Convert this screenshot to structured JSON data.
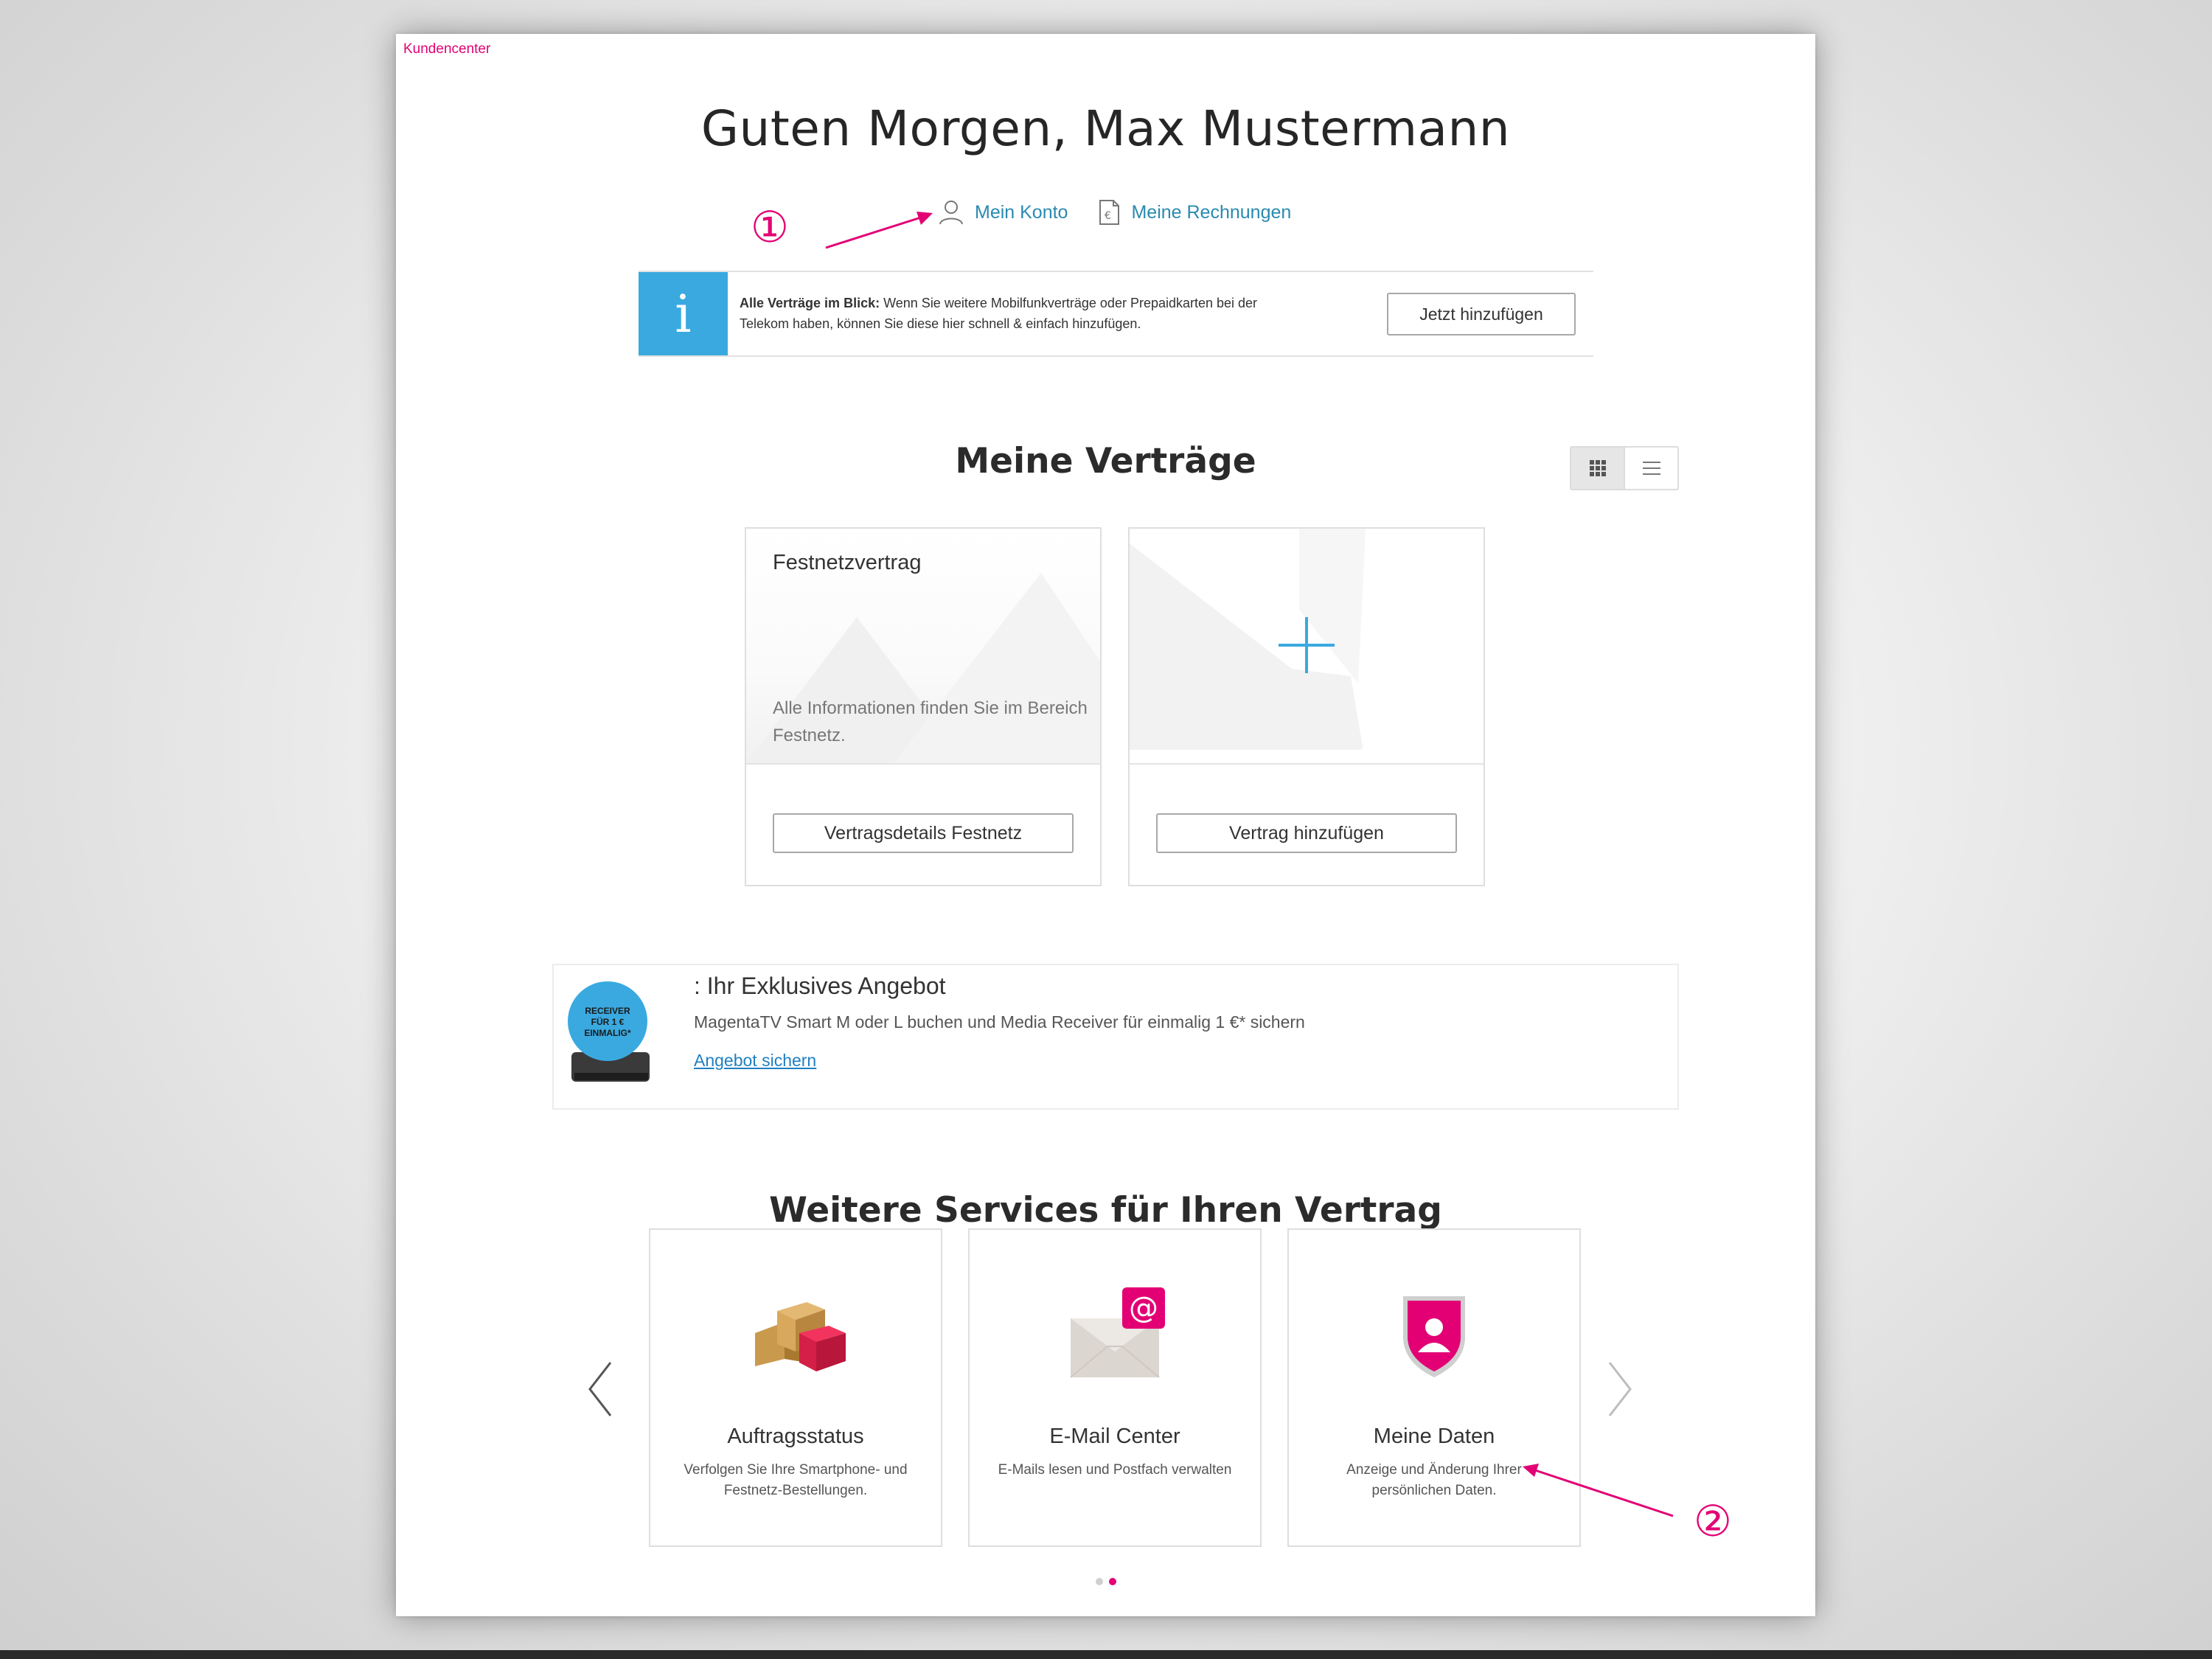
{
  "header": {
    "breadcrumb_link": "Kundencenter",
    "greeting": "Guten Morgen, Max Mustermann"
  },
  "topnav": {
    "account_label": "Mein Konto",
    "invoices_label": "Meine Rechnungen"
  },
  "annotations": {
    "marker_1": "①",
    "marker_2": "②"
  },
  "info_banner": {
    "icon": "info-icon",
    "bold_text": "Alle Verträge im Blick:",
    "text_line1": "Wenn Sie weitere Mobilfunkverträge oder Prepaidkarten bei der",
    "text_line2": "Telekom haben, können Sie diese hier schnell & einfach hinzufügen.",
    "button_label": "Jetzt hinzufügen"
  },
  "contracts": {
    "title": "Meine Verträge",
    "view_options": [
      "grid",
      "list"
    ],
    "selected_view": "grid",
    "cards": [
      {
        "title": "Festnetzvertrag",
        "description": "Alle Informationen finden Sie im Bereich Festnetz.",
        "button_label": "Vertragsdetails Festnetz"
      },
      {
        "icon": "plus-icon",
        "button_label": "Vertrag hinzufügen"
      }
    ]
  },
  "offer": {
    "badge_lines": [
      "RECEIVER",
      "FÜR 1 €",
      "EINMALIG*"
    ],
    "title": ": Ihr Exklusives Angebot",
    "text": "MagentaTV Smart M oder L buchen und Media Receiver für einmalig 1 €* sichern",
    "link_label": "Angebot sichern"
  },
  "services": {
    "title": "Weitere Services für Ihren Vertrag",
    "items": [
      {
        "icon": "boxes-icon",
        "title": "Auftragsstatus",
        "description": "Verfolgen Sie Ihre Smartphone- und Festnetz-Bestellungen."
      },
      {
        "icon": "email-at-icon",
        "title": "E-Mail Center",
        "description": "E-Mails lesen und Postfach verwalten"
      },
      {
        "icon": "user-shield-icon",
        "title": "Meine Daten",
        "description": "Anzeige und Änderung Ihrer persönlichen Daten."
      }
    ],
    "pagination": {
      "pages": 2,
      "active_page": 2
    }
  },
  "colors": {
    "magenta": "#e20074",
    "info_blue": "#3aa9e0",
    "link_blue": "#2a8ab0"
  }
}
